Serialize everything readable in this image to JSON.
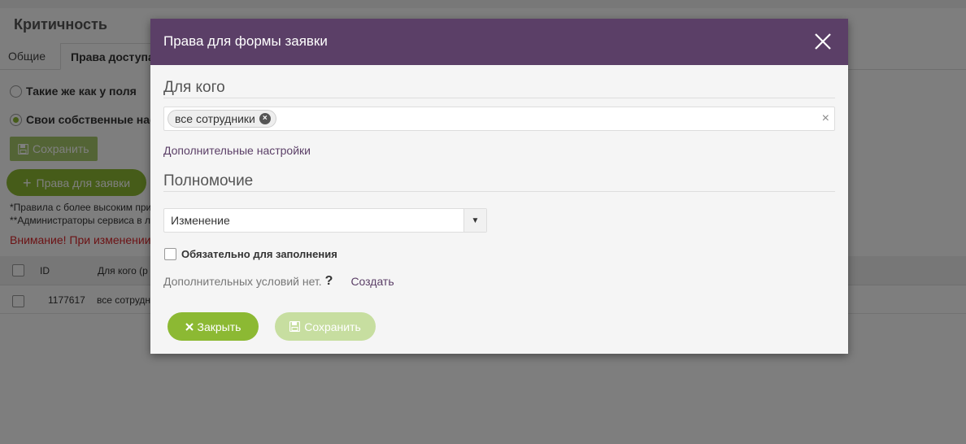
{
  "background": {
    "page_title": "Критичность",
    "tabs": [
      {
        "label": "Общие"
      },
      {
        "label": "Права доступа"
      }
    ],
    "radio_same": "Такие же как у поля",
    "radio_own": "Свои собственные настройки",
    "save_label": "Сохранить",
    "add_rights_label": "Права для заявки",
    "note_1": "*Правила с более высоким приоритетом",
    "note_2": "**Администраторы сервиса в любом случае",
    "warning": "Внимание! При изменении настроек",
    "table": {
      "headers": {
        "id": "ID",
        "for_whom": "Для кого (р"
      },
      "rows": [
        {
          "id": "1177617",
          "for_whom": "все сотрудники"
        }
      ]
    }
  },
  "modal": {
    "title": "Права для формы заявки",
    "for_whom_heading": "Для кого",
    "tags": [
      {
        "label": "все сотрудники"
      }
    ],
    "clear_symbol": "×",
    "more_settings_link": "Дополнительные настройки",
    "permission_heading": "Полномочие",
    "permission_select": {
      "selected": "Изменение"
    },
    "required_checkbox_label": "Обязательно для заполнения",
    "required_checked": false,
    "conditions_text": "Дополнительных условий нет.",
    "help_symbol": "?",
    "create_link": "Создать",
    "close_button": "Закрыть",
    "save_button": "Сохранить"
  },
  "colors": {
    "header_purple": "#5b3f67",
    "green": "#8cb933",
    "green_disabled": "#c7dea0",
    "link_purple": "#5b3f67",
    "warning_red": "#d9262b"
  },
  "icons": {
    "close": "close-icon",
    "tag_remove": "remove-tag-icon",
    "dropdown": "chevron-down-icon",
    "save": "floppy-disk-icon",
    "plus": "plus-icon"
  }
}
